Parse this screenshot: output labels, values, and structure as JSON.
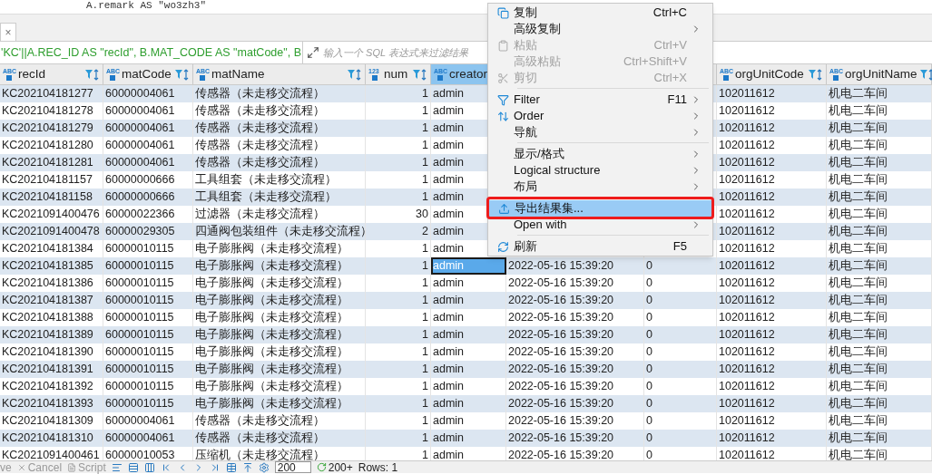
{
  "editor": {
    "code_line": "A.remark AS \"wo3zh3\""
  },
  "tab": {
    "close": "×"
  },
  "filter_bar": {
    "query": "'KC'||A.REC_ID AS \"recId\", B.MAT_CODE AS \"matCode\", B",
    "placeholder": "输入一个 SQL 表达式来过滤结果"
  },
  "table": {
    "columns": [
      {
        "label": "recId",
        "type_label": "ABC",
        "selected": false
      },
      {
        "label": "matCode",
        "type_label": "ABC",
        "selected": false
      },
      {
        "label": "matName",
        "type_label": "ABC",
        "selected": false
      },
      {
        "label": "num",
        "type_label": "123",
        "selected": false
      },
      {
        "label": "creator",
        "type_label": "ABC",
        "selected": true
      },
      {
        "label": "orgUnitCode",
        "type_label": "ABC",
        "selected": false
      },
      {
        "label": "orgUnitName",
        "type_label": "ABC",
        "selected": false
      }
    ],
    "rows": [
      {
        "recId": "KC202104181277",
        "matCode": "60000004061",
        "matName": "传感器（未走移交流程）",
        "num": "1",
        "creator": "admin",
        "orgUnitCode": "102011612",
        "orgUnitName": "机电二车间",
        "selected": false
      },
      {
        "recId": "KC202104181278",
        "matCode": "60000004061",
        "matName": "传感器（未走移交流程）",
        "num": "1",
        "creator": "admin",
        "orgUnitCode": "102011612",
        "orgUnitName": "机电二车间",
        "selected": false
      },
      {
        "recId": "KC202104181279",
        "matCode": "60000004061",
        "matName": "传感器（未走移交流程）",
        "num": "1",
        "creator": "admin",
        "orgUnitCode": "102011612",
        "orgUnitName": "机电二车间",
        "selected": false
      },
      {
        "recId": "KC202104181280",
        "matCode": "60000004061",
        "matName": "传感器（未走移交流程）",
        "num": "1",
        "creator": "admin",
        "orgUnitCode": "102011612",
        "orgUnitName": "机电二车间",
        "selected": false
      },
      {
        "recId": "KC202104181281",
        "matCode": "60000004061",
        "matName": "传感器（未走移交流程）",
        "num": "1",
        "creator": "admin",
        "orgUnitCode": "102011612",
        "orgUnitName": "机电二车间",
        "selected": false
      },
      {
        "recId": "KC202104181157",
        "matCode": "60000000666",
        "matName": "工具组套（未走移交流程）",
        "num": "1",
        "creator": "admin",
        "orgUnitCode": "102011612",
        "orgUnitName": "机电二车间",
        "selected": false
      },
      {
        "recId": "KC202104181158",
        "matCode": "60000000666",
        "matName": "工具组套（未走移交流程）",
        "num": "1",
        "creator": "admin",
        "orgUnitCode": "102011612",
        "orgUnitName": "机电二车间",
        "selected": false
      },
      {
        "recId": "KC2021091400476",
        "matCode": "60000022366",
        "matName": "过滤器（未走移交流程）",
        "num": "30",
        "creator": "admin",
        "orgUnitCode": "102011612",
        "orgUnitName": "机电二车间",
        "selected": false
      },
      {
        "recId": "KC2021091400478",
        "matCode": "60000029305",
        "matName": "四通阀包装组件（未走移交流程）",
        "num": "2",
        "creator": "admin",
        "orgUnitCode": "102011612",
        "orgUnitName": "机电二车间",
        "selected": false
      },
      {
        "recId": "KC202104181384",
        "matCode": "60000010115",
        "matName": "电子膨胀阀（未走移交流程）",
        "num": "1",
        "creator": "admin",
        "orgUnitCode": "102011612",
        "orgUnitName": "机电二车间",
        "selected": false
      },
      {
        "recId": "KC202104181385",
        "matCode": "60000010115",
        "matName": "电子膨胀阀（未走移交流程）",
        "num": "1",
        "creator": "admin",
        "column_6": "2022-05-16 15:39:20",
        "column_7": "0",
        "orgUnitCode": "102011612",
        "orgUnitName": "机电二车间",
        "selected": true
      },
      {
        "recId": "KC202104181386",
        "matCode": "60000010115",
        "matName": "电子膨胀阀（未走移交流程）",
        "num": "1",
        "creator": "admin",
        "column_6": "2022-05-16 15:39:20",
        "column_7": "0",
        "orgUnitCode": "102011612",
        "orgUnitName": "机电二车间",
        "selected": false
      },
      {
        "recId": "KC202104181387",
        "matCode": "60000010115",
        "matName": "电子膨胀阀（未走移交流程）",
        "num": "1",
        "creator": "admin",
        "column_6": "2022-05-16 15:39:20",
        "column_7": "0",
        "orgUnitCode": "102011612",
        "orgUnitName": "机电二车间",
        "selected": false
      },
      {
        "recId": "KC202104181388",
        "matCode": "60000010115",
        "matName": "电子膨胀阀（未走移交流程）",
        "num": "1",
        "creator": "admin",
        "column_6": "2022-05-16 15:39:20",
        "column_7": "0",
        "orgUnitCode": "102011612",
        "orgUnitName": "机电二车间",
        "selected": false
      },
      {
        "recId": "KC202104181389",
        "matCode": "60000010115",
        "matName": "电子膨胀阀（未走移交流程）",
        "num": "1",
        "creator": "admin",
        "column_6": "2022-05-16 15:39:20",
        "column_7": "0",
        "orgUnitCode": "102011612",
        "orgUnitName": "机电二车间",
        "selected": false
      },
      {
        "recId": "KC202104181390",
        "matCode": "60000010115",
        "matName": "电子膨胀阀（未走移交流程）",
        "num": "1",
        "creator": "admin",
        "column_6": "2022-05-16 15:39:20",
        "column_7": "0",
        "orgUnitCode": "102011612",
        "orgUnitName": "机电二车间",
        "selected": false
      },
      {
        "recId": "KC202104181391",
        "matCode": "60000010115",
        "matName": "电子膨胀阀（未走移交流程）",
        "num": "1",
        "creator": "admin",
        "column_6": "2022-05-16 15:39:20",
        "column_7": "0",
        "orgUnitCode": "102011612",
        "orgUnitName": "机电二车间",
        "selected": false
      },
      {
        "recId": "KC202104181392",
        "matCode": "60000010115",
        "matName": "电子膨胀阀（未走移交流程）",
        "num": "1",
        "creator": "admin",
        "column_6": "2022-05-16 15:39:20",
        "column_7": "0",
        "orgUnitCode": "102011612",
        "orgUnitName": "机电二车间",
        "selected": false
      },
      {
        "recId": "KC202104181393",
        "matCode": "60000010115",
        "matName": "电子膨胀阀（未走移交流程）",
        "num": "1",
        "creator": "admin",
        "column_6": "2022-05-16 15:39:20",
        "column_7": "0",
        "orgUnitCode": "102011612",
        "orgUnitName": "机电二车间",
        "selected": false
      },
      {
        "recId": "KC202104181309",
        "matCode": "60000004061",
        "matName": "传感器（未走移交流程）",
        "num": "1",
        "creator": "admin",
        "column_6": "2022-05-16 15:39:20",
        "column_7": "0",
        "orgUnitCode": "102011612",
        "orgUnitName": "机电二车间",
        "selected": false
      },
      {
        "recId": "KC202104181310",
        "matCode": "60000004061",
        "matName": "传感器（未走移交流程）",
        "num": "1",
        "creator": "admin",
        "column_6": "2022-05-16 15:39:20",
        "column_7": "0",
        "orgUnitCode": "102011612",
        "orgUnitName": "机电二车间",
        "selected": false
      },
      {
        "recId": "KC2021091400461",
        "matCode": "60000010053",
        "matName": "压缩机（未走移交流程）",
        "num": "1",
        "creator": "admin",
        "column_6": "2022-05-16 15:39:20",
        "column_7": "0",
        "orgUnitCode": "102011612",
        "orgUnitName": "机电二车间",
        "selected": false
      }
    ]
  },
  "context_menu": {
    "items": [
      {
        "kind": "item",
        "label": "复制",
        "shortcut": "Ctrl+C",
        "submenu": false,
        "disabled": false,
        "selected": false,
        "outlined": false
      },
      {
        "kind": "item",
        "label": "高级复制",
        "submenu": true,
        "disabled": false,
        "selected": false,
        "outlined": false
      },
      {
        "kind": "item",
        "label": "粘贴",
        "shortcut": "Ctrl+V",
        "submenu": false,
        "disabled": true,
        "selected": false,
        "outlined": false
      },
      {
        "kind": "item",
        "label": "高级粘贴",
        "shortcut": "Ctrl+Shift+V",
        "submenu": false,
        "disabled": true,
        "selected": false,
        "outlined": false
      },
      {
        "kind": "item",
        "label": "剪切",
        "shortcut": "Ctrl+X",
        "submenu": false,
        "disabled": true,
        "selected": false,
        "outlined": false
      },
      {
        "kind": "separator"
      },
      {
        "kind": "item",
        "label": "Filter",
        "shortcut": "F11",
        "submenu": true,
        "disabled": false,
        "selected": false,
        "outlined": false
      },
      {
        "kind": "item",
        "label": "Order",
        "submenu": true,
        "disabled": false,
        "selected": false,
        "outlined": false
      },
      {
        "kind": "item",
        "label": "导航",
        "submenu": true,
        "disabled": false,
        "selected": false,
        "outlined": false
      },
      {
        "kind": "separator"
      },
      {
        "kind": "item",
        "label": "显示/格式",
        "submenu": true,
        "disabled": false,
        "selected": false,
        "outlined": false
      },
      {
        "kind": "item",
        "label": "Logical structure",
        "submenu": true,
        "disabled": false,
        "selected": false,
        "outlined": false
      },
      {
        "kind": "item",
        "label": "布局",
        "submenu": true,
        "disabled": false,
        "selected": false,
        "outlined": false
      },
      {
        "kind": "separator"
      },
      {
        "kind": "item",
        "label": "导出结果集...",
        "submenu": false,
        "disabled": false,
        "selected": true,
        "outlined": true
      },
      {
        "kind": "item",
        "label": "Open with",
        "submenu": true,
        "disabled": false,
        "selected": false,
        "outlined": false
      },
      {
        "kind": "separator"
      },
      {
        "kind": "item",
        "label": "刷新",
        "shortcut": "F5",
        "submenu": false,
        "disabled": false,
        "selected": false,
        "outlined": false
      }
    ]
  },
  "bottom_toolbar": {
    "save": "ve",
    "cancel": "Cancel",
    "script": "Script",
    "fetch_size": "200",
    "fetch_more": "200+",
    "rows": "Rows: 1"
  }
}
